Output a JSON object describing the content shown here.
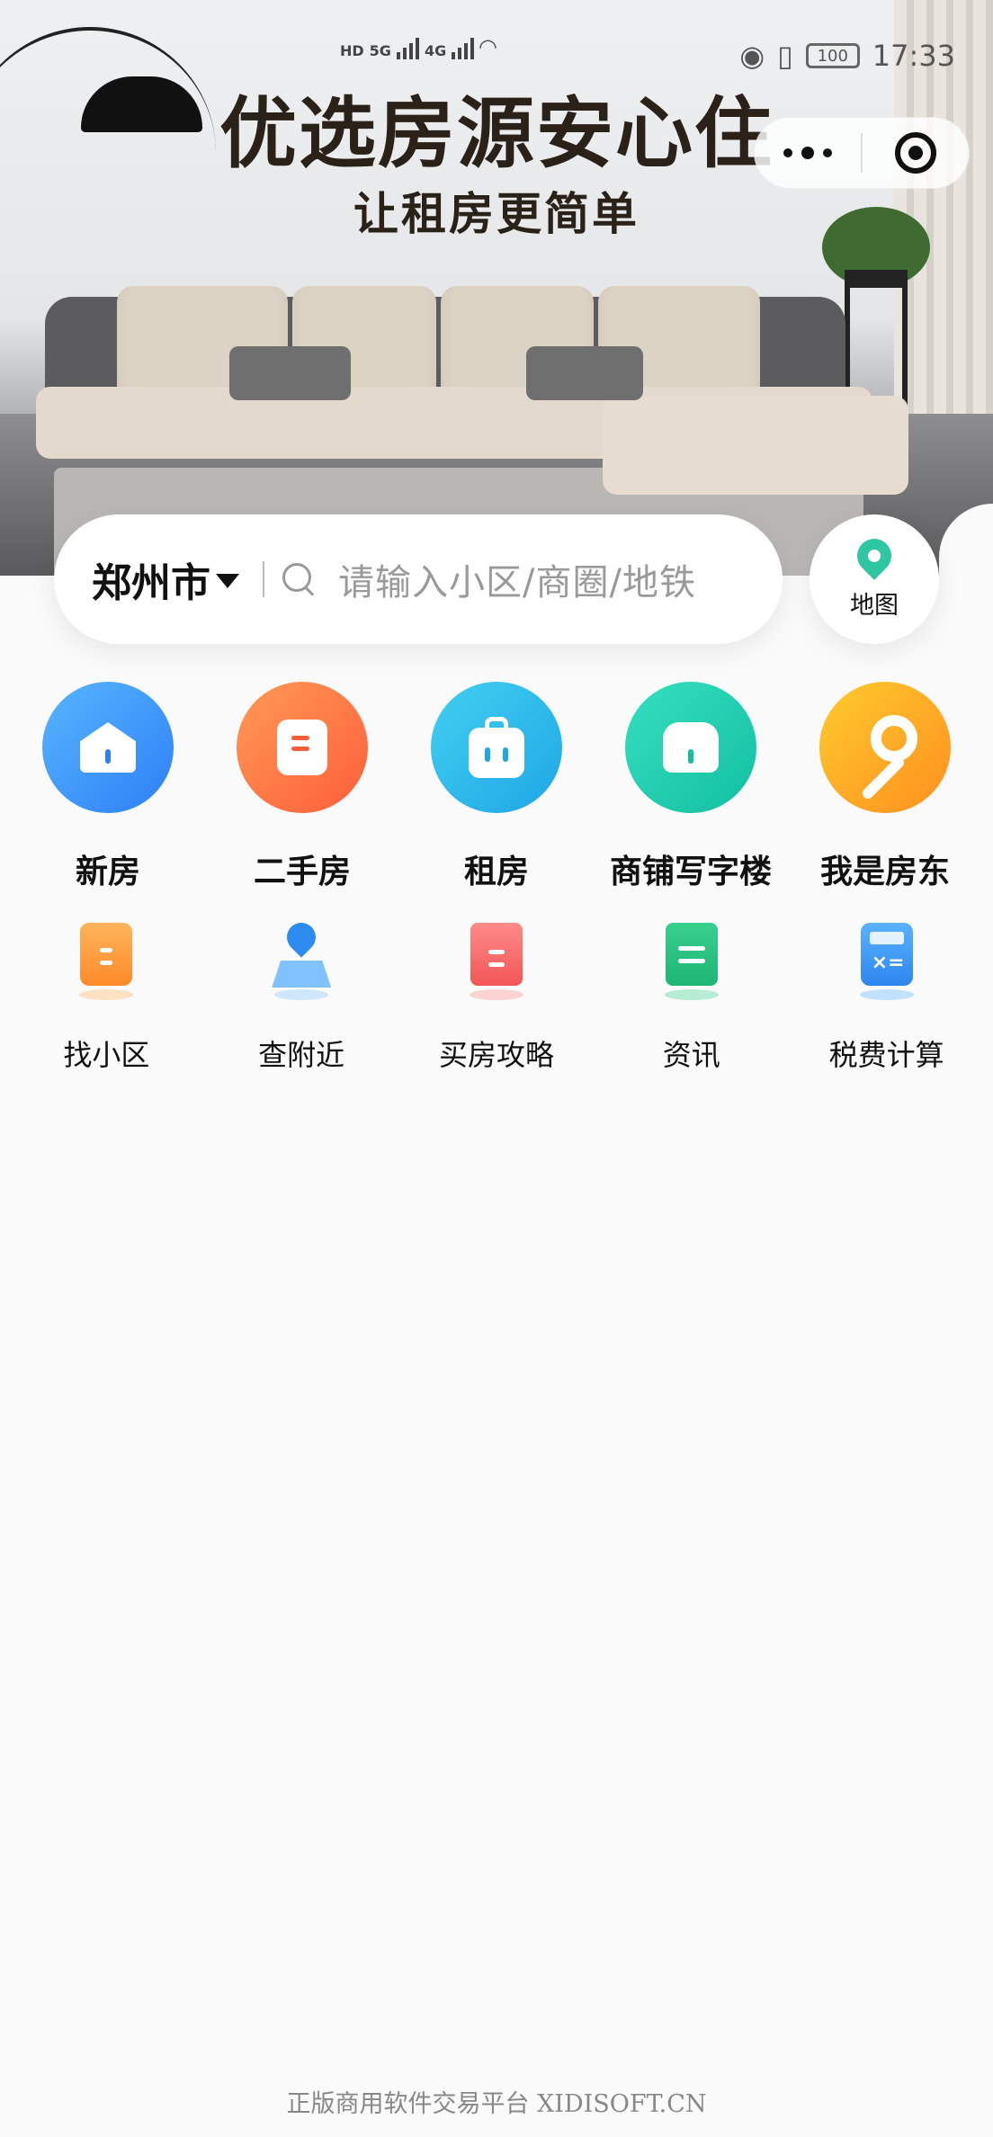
{
  "status": {
    "time": "17:33",
    "battery": "100",
    "network_1": "5G",
    "network_2": "4G",
    "hd_1": "HD",
    "hd_2": "HD"
  },
  "banner": {
    "title": "优选房源安心住",
    "subtitle": "让租房更简单"
  },
  "search": {
    "city": "郑州市",
    "placeholder": "请输入小区/商圈/地铁"
  },
  "map": {
    "label": "地图"
  },
  "main_categories": [
    {
      "label": "新房",
      "icon": "house-icon",
      "color": "#2d7ff5"
    },
    {
      "label": "二手房",
      "icon": "document-icon",
      "color": "#ff5e3a"
    },
    {
      "label": "租房",
      "icon": "suitcase-icon",
      "color": "#1fa6e6"
    },
    {
      "label": "商铺写字楼",
      "icon": "shop-icon",
      "color": "#12bfa0"
    },
    {
      "label": "我是房东",
      "icon": "key-icon",
      "color": "#ff8f1f"
    }
  ],
  "sub_categories": [
    {
      "label": "找小区",
      "icon": "building-icon"
    },
    {
      "label": "查附近",
      "icon": "location-pin-icon"
    },
    {
      "label": "买房攻略",
      "icon": "book-icon"
    },
    {
      "label": "资讯",
      "icon": "news-doc-icon"
    },
    {
      "label": "税费计算",
      "icon": "calculator-icon"
    }
  ],
  "footer": {
    "text": "正版商用软件交易平台 XIDISOFT.CN"
  }
}
